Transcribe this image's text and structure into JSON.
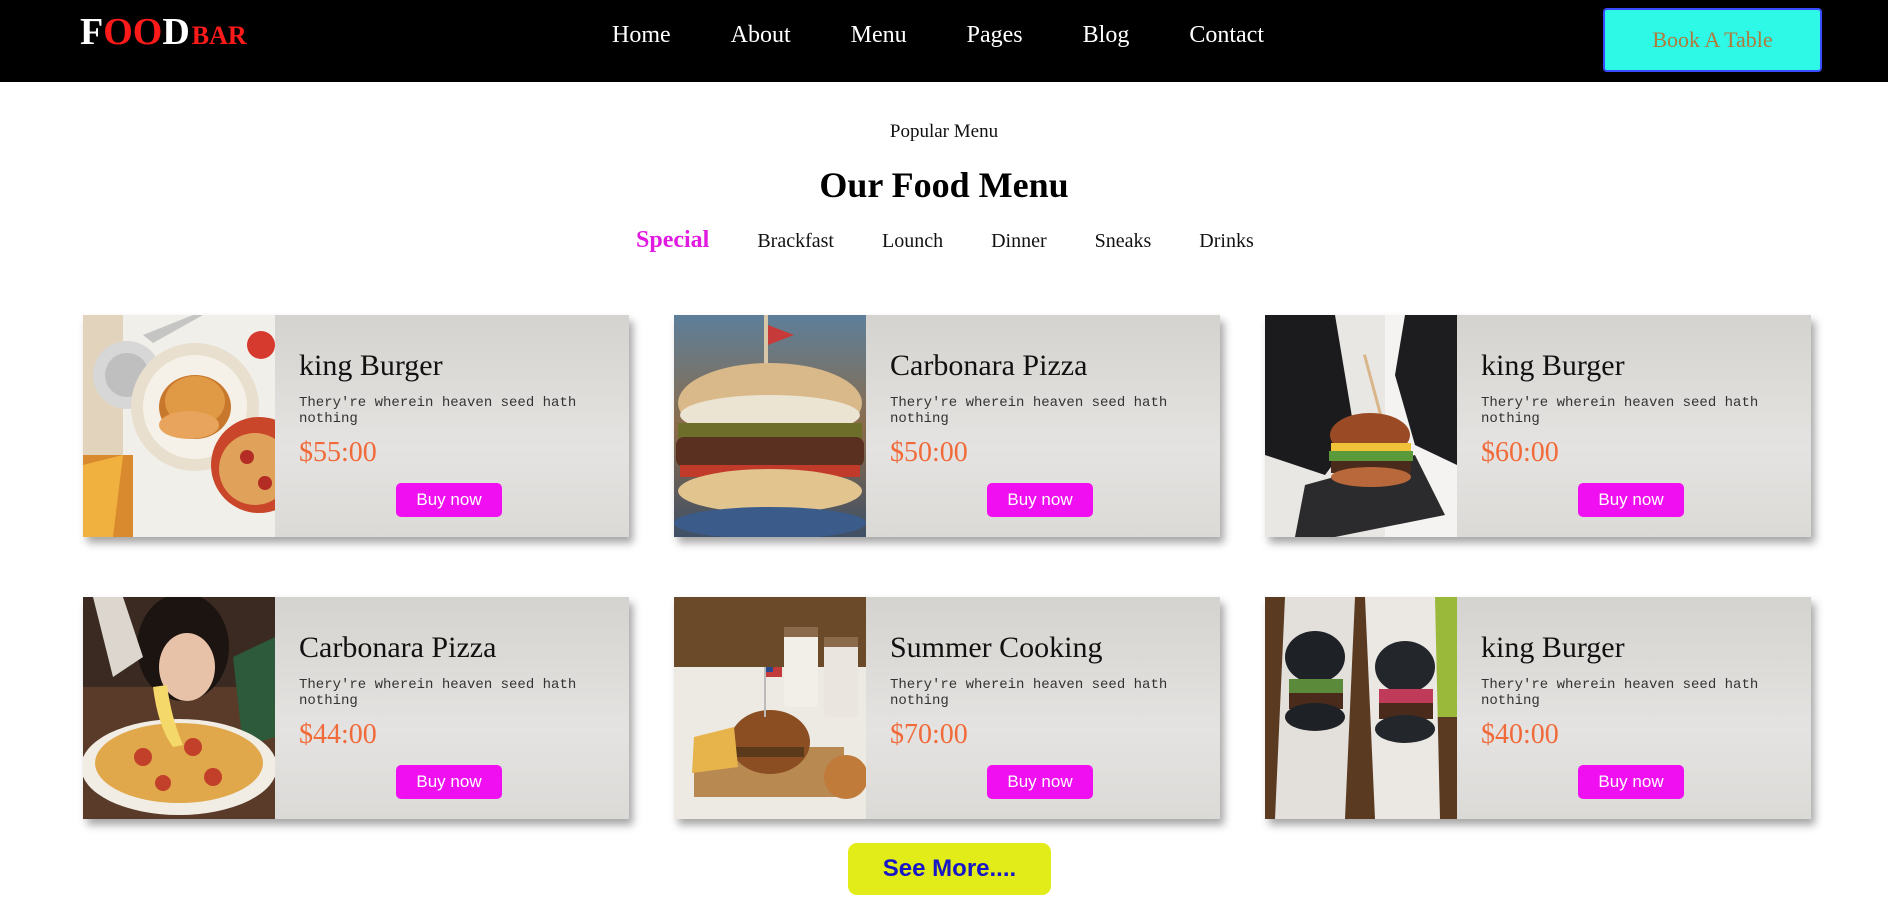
{
  "header": {
    "logo": {
      "part1": "F",
      "part2": "OO",
      "part3": "D",
      "part4": "BAR"
    },
    "nav": [
      "Home",
      "About",
      "Menu",
      "Pages",
      "Blog",
      "Contact"
    ],
    "cta_label": "Book A Table"
  },
  "section": {
    "eyebrow": "Popular Menu",
    "title": "Our Food Menu",
    "tabs": [
      "Special",
      "Brackfast",
      "Lounch",
      "Dinner",
      "Sneaks",
      "Drinks"
    ],
    "active_tab": "Special"
  },
  "cards": [
    {
      "name": "king Burger",
      "desc": "Thery're wherein heaven seed hath nothing",
      "price": "$55:00",
      "button": "Buy now",
      "image": "burger-plate-photo"
    },
    {
      "name": "Carbonara Pizza",
      "desc": "Thery're wherein heaven seed hath nothing",
      "price": "$50:00",
      "button": "Buy now",
      "image": "burger-closeup-photo"
    },
    {
      "name": "king Burger",
      "desc": "Thery're wherein heaven seed hath nothing",
      "price": "$60:00",
      "button": "Buy now",
      "image": "burger-gloves-photo"
    },
    {
      "name": "Carbonara Pizza",
      "desc": "Thery're wherein heaven seed hath nothing",
      "price": "$44:00",
      "button": "Buy now",
      "image": "pizza-cheese-pull-photo"
    },
    {
      "name": "Summer Cooking",
      "desc": "Thery're wherein heaven seed hath nothing",
      "price": "$70:00",
      "button": "Buy now",
      "image": "burger-fries-flags-photo"
    },
    {
      "name": "king Burger",
      "desc": "Thery're wherein heaven seed hath nothing",
      "price": "$40:00",
      "button": "Buy now",
      "image": "black-bun-burgers-photo"
    }
  ],
  "see_more_label": "See More....",
  "colors": {
    "header_bg": "#000000",
    "logo_accent": "#ff1a1a",
    "cta_bg": "#2ef8e6",
    "tab_active": "#e01ae0",
    "price": "#f06a3a",
    "buy_button": "#f00ff0",
    "see_more_bg": "#e2ec18",
    "see_more_text": "#1717c8"
  }
}
